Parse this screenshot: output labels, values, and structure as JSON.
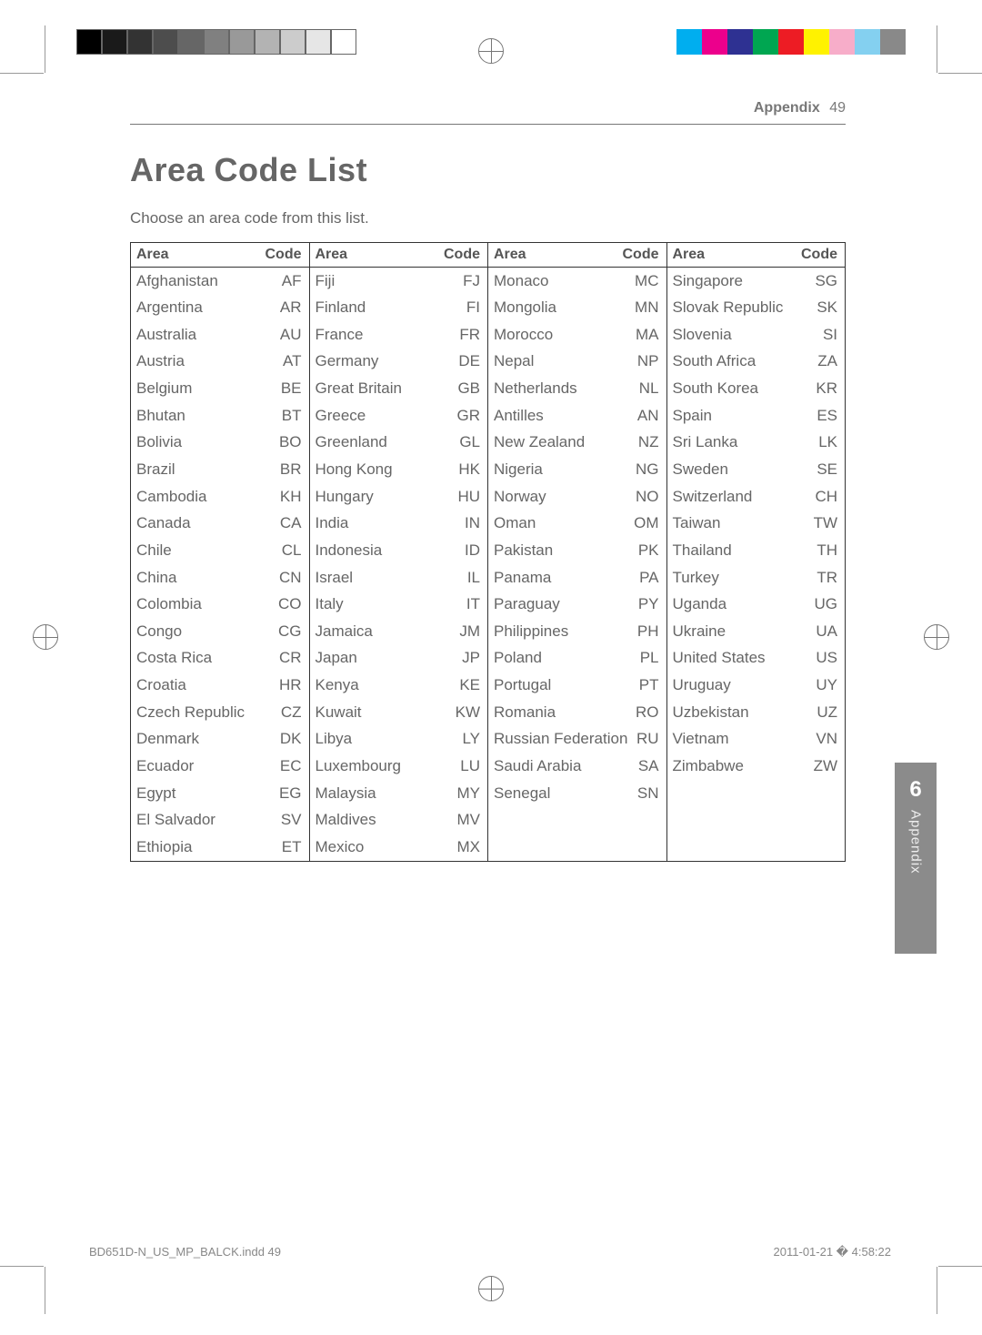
{
  "header": {
    "section": "Appendix",
    "page_number": "49"
  },
  "title": "Area Code List",
  "instruction": "Choose an area code from this list.",
  "table": {
    "col_headers": {
      "area": "Area",
      "code": "Code"
    },
    "columns": [
      [
        {
          "area": "Afghanistan",
          "code": "AF"
        },
        {
          "area": "Argentina",
          "code": "AR"
        },
        {
          "area": "Australia",
          "code": "AU"
        },
        {
          "area": "Austria",
          "code": "AT"
        },
        {
          "area": "Belgium",
          "code": "BE"
        },
        {
          "area": "Bhutan",
          "code": "BT"
        },
        {
          "area": "Bolivia",
          "code": "BO"
        },
        {
          "area": "Brazil",
          "code": "BR"
        },
        {
          "area": "Cambodia",
          "code": "KH"
        },
        {
          "area": "Canada",
          "code": "CA"
        },
        {
          "area": "Chile",
          "code": "CL"
        },
        {
          "area": "China",
          "code": "CN"
        },
        {
          "area": "Colombia",
          "code": "CO"
        },
        {
          "area": "Congo",
          "code": "CG"
        },
        {
          "area": "Costa Rica",
          "code": "CR"
        },
        {
          "area": "Croatia",
          "code": "HR"
        },
        {
          "area": "Czech Republic",
          "code": "CZ"
        },
        {
          "area": "Denmark",
          "code": "DK"
        },
        {
          "area": "Ecuador",
          "code": "EC"
        },
        {
          "area": "Egypt",
          "code": "EG"
        },
        {
          "area": "El Salvador",
          "code": "SV"
        },
        {
          "area": "Ethiopia",
          "code": "ET"
        }
      ],
      [
        {
          "area": "Fiji",
          "code": "FJ"
        },
        {
          "area": "Finland",
          "code": "FI"
        },
        {
          "area": "France",
          "code": "FR"
        },
        {
          "area": "Germany",
          "code": "DE"
        },
        {
          "area": "Great Britain",
          "code": "GB"
        },
        {
          "area": "Greece",
          "code": "GR"
        },
        {
          "area": "Greenland",
          "code": "GL"
        },
        {
          "area": "Hong Kong",
          "code": "HK"
        },
        {
          "area": "Hungary",
          "code": "HU"
        },
        {
          "area": "India",
          "code": "IN"
        },
        {
          "area": "Indonesia",
          "code": "ID"
        },
        {
          "area": "Israel",
          "code": "IL"
        },
        {
          "area": "Italy",
          "code": "IT"
        },
        {
          "area": "Jamaica",
          "code": "JM"
        },
        {
          "area": "Japan",
          "code": "JP"
        },
        {
          "area": "Kenya",
          "code": "KE"
        },
        {
          "area": "Kuwait",
          "code": "KW"
        },
        {
          "area": "Libya",
          "code": "LY"
        },
        {
          "area": "Luxembourg",
          "code": "LU"
        },
        {
          "area": "Malaysia",
          "code": "MY"
        },
        {
          "area": "Maldives",
          "code": "MV"
        },
        {
          "area": "Mexico",
          "code": "MX"
        }
      ],
      [
        {
          "area": "Monaco",
          "code": "MC"
        },
        {
          "area": "Mongolia",
          "code": "MN"
        },
        {
          "area": "Morocco",
          "code": "MA"
        },
        {
          "area": "Nepal",
          "code": "NP"
        },
        {
          "area": "Netherlands",
          "code": "NL"
        },
        {
          "area": "Antilles",
          "code": "AN"
        },
        {
          "area": "New Zealand",
          "code": "NZ"
        },
        {
          "area": "Nigeria",
          "code": "NG"
        },
        {
          "area": "Norway",
          "code": "NO"
        },
        {
          "area": "Oman",
          "code": "OM"
        },
        {
          "area": "Pakistan",
          "code": "PK"
        },
        {
          "area": "Panama",
          "code": "PA"
        },
        {
          "area": "Paraguay",
          "code": "PY"
        },
        {
          "area": "Philippines",
          "code": "PH"
        },
        {
          "area": "Poland",
          "code": "PL"
        },
        {
          "area": "Portugal",
          "code": "PT"
        },
        {
          "area": "Romania",
          "code": "RO"
        },
        {
          "area": "Russian Federation",
          "code": "RU"
        },
        {
          "area": "Saudi Arabia",
          "code": "SA"
        },
        {
          "area": "Senegal",
          "code": "SN"
        }
      ],
      [
        {
          "area": "Singapore",
          "code": "SG"
        },
        {
          "area": "Slovak Republic",
          "code": "SK"
        },
        {
          "area": "Slovenia",
          "code": "SI"
        },
        {
          "area": "South Africa",
          "code": "ZA"
        },
        {
          "area": "South Korea",
          "code": "KR"
        },
        {
          "area": "Spain",
          "code": "ES"
        },
        {
          "area": "Sri Lanka",
          "code": "LK"
        },
        {
          "area": "Sweden",
          "code": "SE"
        },
        {
          "area": "Switzerland",
          "code": "CH"
        },
        {
          "area": "Taiwan",
          "code": "TW"
        },
        {
          "area": "Thailand",
          "code": "TH"
        },
        {
          "area": "Turkey",
          "code": "TR"
        },
        {
          "area": "Uganda",
          "code": "UG"
        },
        {
          "area": "Ukraine",
          "code": "UA"
        },
        {
          "area": "United States",
          "code": "US"
        },
        {
          "area": "Uruguay",
          "code": "UY"
        },
        {
          "area": "Uzbekistan",
          "code": "UZ"
        },
        {
          "area": "Vietnam",
          "code": "VN"
        },
        {
          "area": "Zimbabwe",
          "code": "ZW"
        }
      ]
    ]
  },
  "side_tab": {
    "number": "6",
    "label": "Appendix"
  },
  "footer": {
    "file": "BD651D-N_US_MP_BALCK.indd   49",
    "timestamp": "2011-01-21   � 4:58:22"
  },
  "print_bars": {
    "left": [
      "#000000",
      "#1a1a1a",
      "#333333",
      "#4d4d4d",
      "#666666",
      "#808080",
      "#999999",
      "#b3b3b3",
      "#cccccc",
      "#e6e6e6",
      "#ffffff"
    ],
    "right": [
      "#00aeef",
      "#ec008c",
      "#2e3192",
      "#00a651",
      "#ed1c24",
      "#fff200",
      "#f7adc9",
      "#84d0f0",
      "#898989"
    ]
  }
}
